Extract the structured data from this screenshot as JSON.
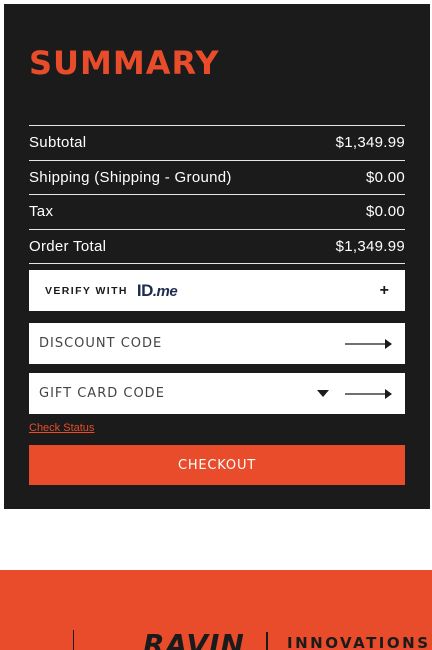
{
  "summary": {
    "title": "SUMMARY",
    "rows": [
      {
        "label": "Subtotal",
        "value": "$1,349.99"
      },
      {
        "label": "Shipping (Shipping - Ground)",
        "value": "$0.00"
      },
      {
        "label": "Tax",
        "value": "$0.00"
      },
      {
        "label": "Order Total",
        "value": "$1,349.99"
      }
    ]
  },
  "verify": {
    "label": "VERIFY WITH",
    "logo_text": "ID",
    "logo_suffix": ".me",
    "expand_symbol": "+"
  },
  "discount": {
    "placeholder": "DISCOUNT CODE",
    "value": ""
  },
  "gift_card": {
    "placeholder": "GIFT CARD CODE",
    "value": ""
  },
  "check_status": "Check Status",
  "checkout_label": "CHECKOUT",
  "footer": {
    "logo_text": "RAVIN",
    "tagline": "INNOVATIONS"
  },
  "icons": [
    "arrow-right-icon",
    "chevron-down-icon",
    "plus-icon"
  ],
  "colors": {
    "accent": "#e84c2b",
    "panel": "#1b1b1b",
    "text_light": "#ffffff",
    "idme_navy": "#1e2d4e"
  }
}
